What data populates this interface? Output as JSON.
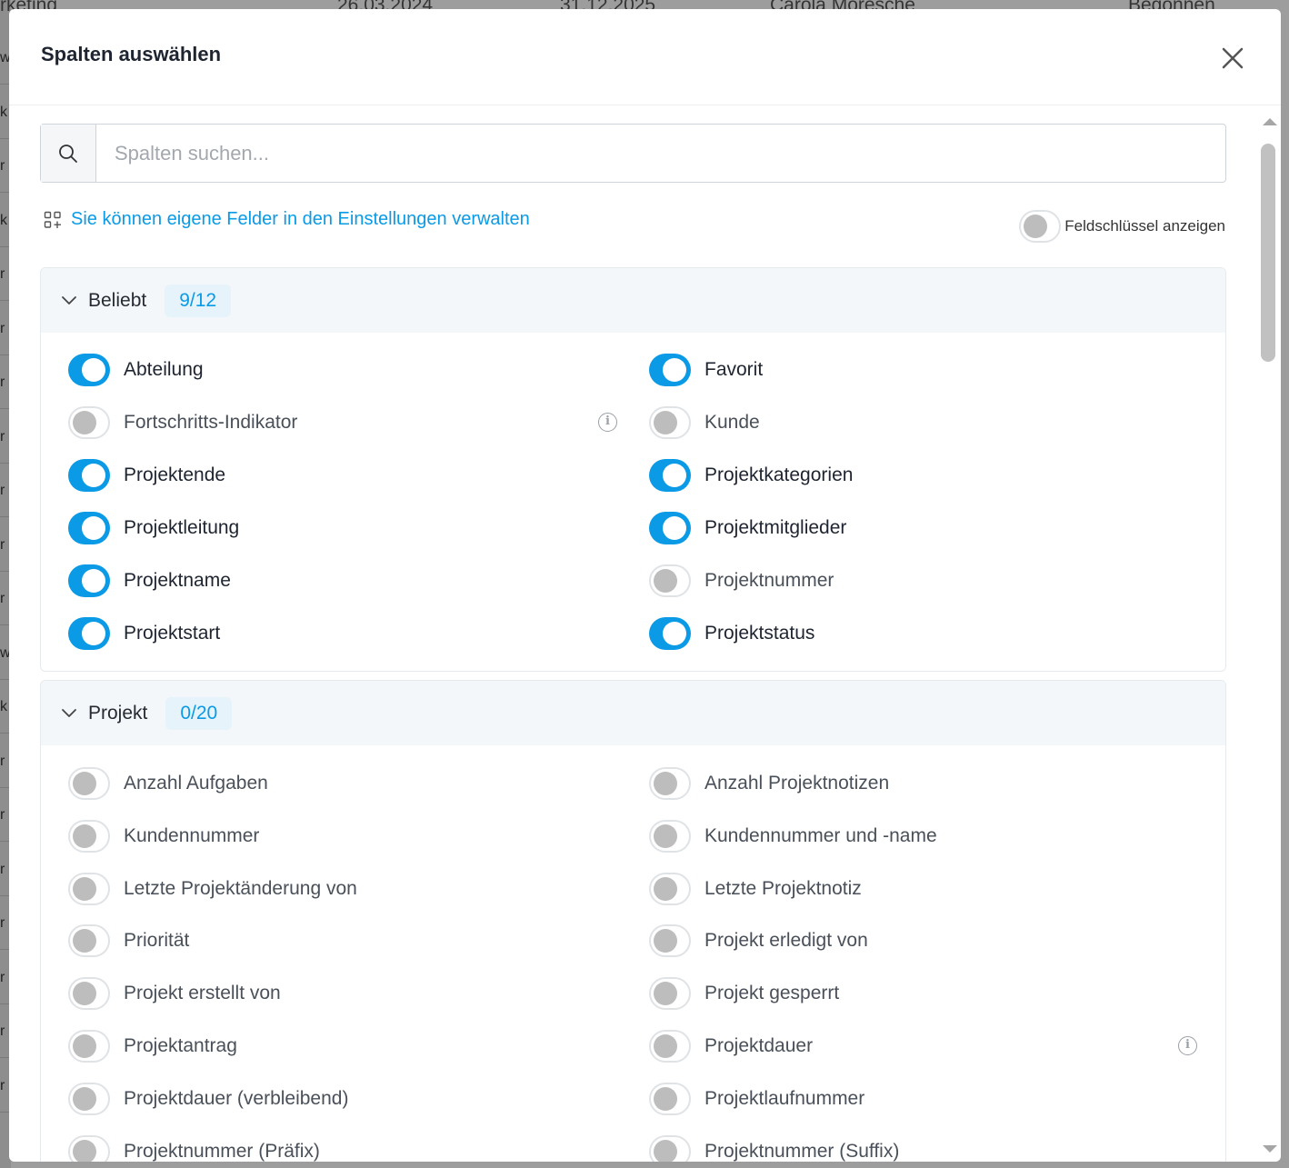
{
  "background": {
    "row_cells": [
      "rketing",
      "26.03.2024",
      "31.12.2025",
      "Carola Moresche",
      "Begonnen"
    ],
    "left_chars": [
      "w",
      "k",
      "r",
      "k",
      "r",
      "r",
      "r",
      "r",
      "r",
      "r",
      "r",
      "w",
      "k",
      "r",
      "r",
      "r",
      "r",
      "r",
      "r",
      "r"
    ]
  },
  "dialog": {
    "title": "Spalten auswählen",
    "close_icon": "close-icon",
    "search": {
      "placeholder": "Spalten suchen...",
      "value": "",
      "icon": "search-icon"
    },
    "manage_link": {
      "label": "Sie können eigene Felder in den Einstellungen verwalten",
      "icon": "grid-plus-icon"
    },
    "field_key_toggle": {
      "label": "Feldschlüssel anzeigen",
      "on": false
    },
    "sections": [
      {
        "title": "Beliebt",
        "count": "9/12",
        "expanded": true,
        "options": [
          {
            "label": "Abteilung",
            "on": true
          },
          {
            "label": "Favorit",
            "on": true
          },
          {
            "label": "Fortschritts-Indikator",
            "on": false,
            "info": true
          },
          {
            "label": "Kunde",
            "on": false
          },
          {
            "label": "Projektende",
            "on": true
          },
          {
            "label": "Projektkategorien",
            "on": true
          },
          {
            "label": "Projektleitung",
            "on": true
          },
          {
            "label": "Projektmitglieder",
            "on": true
          },
          {
            "label": "Projektname",
            "on": true
          },
          {
            "label": "Projektnummer",
            "on": false
          },
          {
            "label": "Projektstart",
            "on": true
          },
          {
            "label": "Projektstatus",
            "on": true
          }
        ]
      },
      {
        "title": "Projekt",
        "count": "0/20",
        "expanded": true,
        "options": [
          {
            "label": "Anzahl Aufgaben",
            "on": false
          },
          {
            "label": "Anzahl Projektnotizen",
            "on": false
          },
          {
            "label": "Kundennummer",
            "on": false
          },
          {
            "label": "Kundennummer und -name",
            "on": false
          },
          {
            "label": "Letzte Projektänderung von",
            "on": false
          },
          {
            "label": "Letzte Projektnotiz",
            "on": false
          },
          {
            "label": "Priorität",
            "on": false
          },
          {
            "label": "Projekt erledigt von",
            "on": false
          },
          {
            "label": "Projekt erstellt von",
            "on": false
          },
          {
            "label": "Projekt gesperrt",
            "on": false
          },
          {
            "label": "Projektantrag",
            "on": false
          },
          {
            "label": "Projektdauer",
            "on": false,
            "info": true
          },
          {
            "label": "Projektdauer (verbleibend)",
            "on": false
          },
          {
            "label": "Projektlaufnummer",
            "on": false
          },
          {
            "label": "Projektnummer (Präfix)",
            "on": false
          },
          {
            "label": "Projektnummer (Suffix)",
            "on": false
          }
        ]
      }
    ]
  }
}
